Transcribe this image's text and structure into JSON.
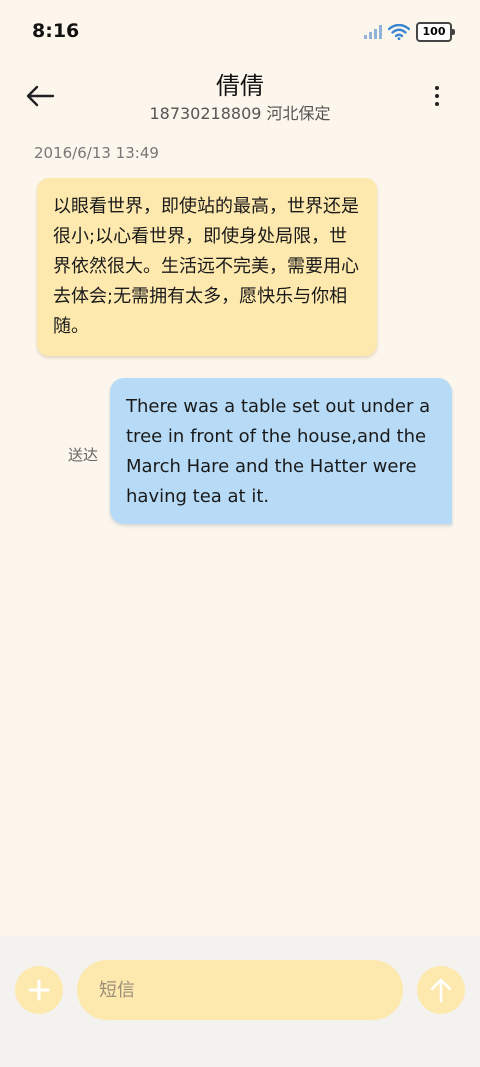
{
  "status_bar": {
    "time": "8:16",
    "battery": "100",
    "icons": [
      "signal-icon",
      "wifi-icon",
      "battery-icon"
    ]
  },
  "header": {
    "contact_name": "倩倩",
    "contact_detail": "18730218809 河北保定",
    "icons": [
      "back-arrow-icon",
      "more-vertical-icon"
    ]
  },
  "conversation": {
    "timestamp": "2016/6/13 13:49",
    "messages": [
      {
        "direction": "incoming",
        "text": "以眼看世界，即使站的最高，世界还是很小;以心看世界，即使身处局限，世界依然很大。生活远不完美，需要用心去体会;无需拥有太多，愿快乐与你相随。"
      },
      {
        "direction": "outgoing",
        "text": "There was a table set out under a tree in front of the house,and the March Hare and the Hatter were having tea at it.",
        "status": "送达"
      }
    ]
  },
  "input_bar": {
    "placeholder": "短信",
    "value": "",
    "icons": [
      "plus-icon",
      "send-arrow-up-icon"
    ]
  },
  "colors": {
    "background": "#fcf6ec",
    "incoming_bubble": "#fde8ae",
    "outgoing_bubble": "#b7dbf6",
    "accent": "#fde8ae",
    "bottom_bar": "#f4f2ef"
  }
}
